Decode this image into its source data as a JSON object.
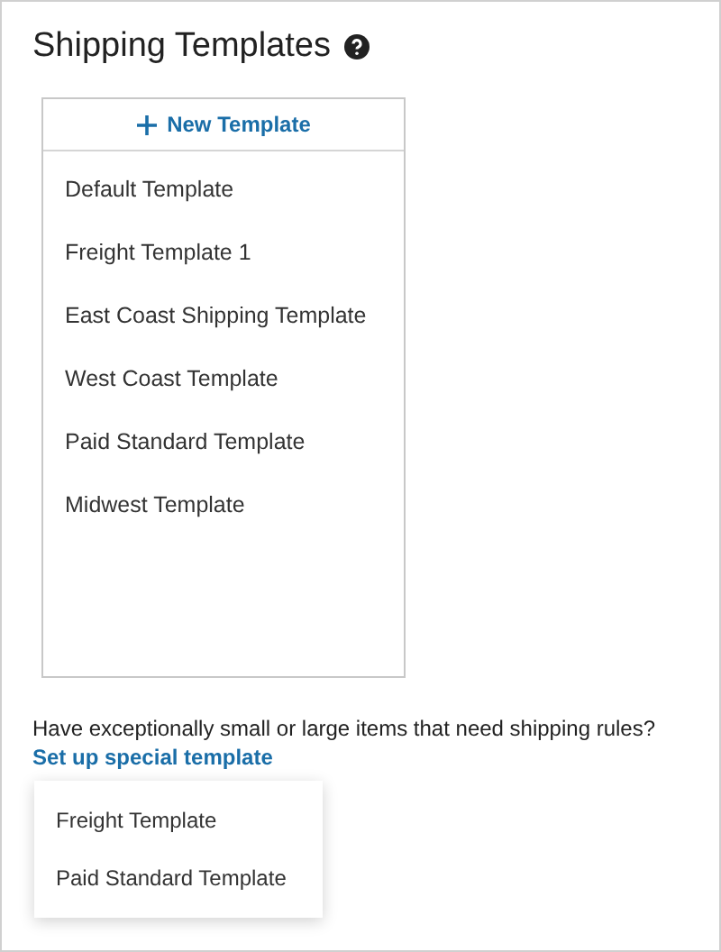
{
  "title": "Shipping Templates",
  "new_template_button": "New Template",
  "templates": [
    "Default Template",
    "Freight Template 1",
    "East Coast Shipping Template",
    "West Coast Template",
    "Paid Standard Template",
    "Midwest Template"
  ],
  "prompt": "Have exceptionally small or large items that need shipping rules?",
  "link": "Set up special template",
  "menu_items": [
    "Freight Template",
    "Paid Standard Template"
  ]
}
